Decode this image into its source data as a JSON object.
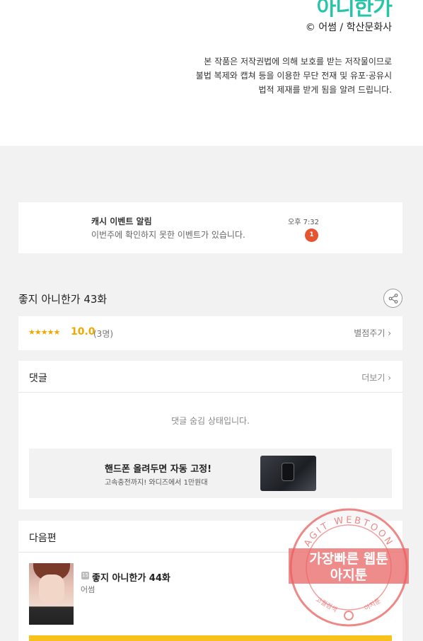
{
  "hero": {
    "logo_text": "아니한가",
    "copyright": "© 어썸 / 학산문화사",
    "notice_lines": [
      "본 작품은 저작권법에 의해 보호를 받는 저작물이므로",
      "불법 복제와 캡쳐 등을 이용한 무단 전재 및 유포·공유시",
      "법적 제재를 받게 됨을 알려 드립니다."
    ]
  },
  "notification": {
    "title": "캐시 이벤트 알림",
    "message": "이번주에 확인하지 못한 이벤트가 있습니다.",
    "time": "오후 7:32",
    "badge_count": "1"
  },
  "episode": {
    "title": "좋지 아니한가 43화",
    "share_icon": "share-icon"
  },
  "rating": {
    "stars": "★★★★★",
    "star_value": 5,
    "score": "10.0",
    "count": "(3명)",
    "rate_link": "별점주기 ›"
  },
  "comments": {
    "header": "댓글",
    "more": "더보기 ›",
    "hidden_message": "댓글 숨김 상태입니다."
  },
  "ad": {
    "title": "핸드폰 올려두면 자동 고정!",
    "subtitle": "고속충전까지! 와디즈에서 1만원대"
  },
  "next_episode": {
    "header": "다음편",
    "age_badge": "15",
    "title": "좋지 아니한가 44화",
    "author": "어썸"
  },
  "watermark": {
    "top_arc": "AGIT WEBTOON",
    "line1": "가장빠른 웹툰",
    "line2": "아지툰",
    "bottom_left": "고퀄검색",
    "bottom_right": "아지툰"
  },
  "colors": {
    "accent_orange": "#e5542f",
    "star_yellow": "#f0a800",
    "bar_yellow": "#f7c21b",
    "logo_teal": "#27c5a8",
    "watermark_red": "#e8605f"
  }
}
